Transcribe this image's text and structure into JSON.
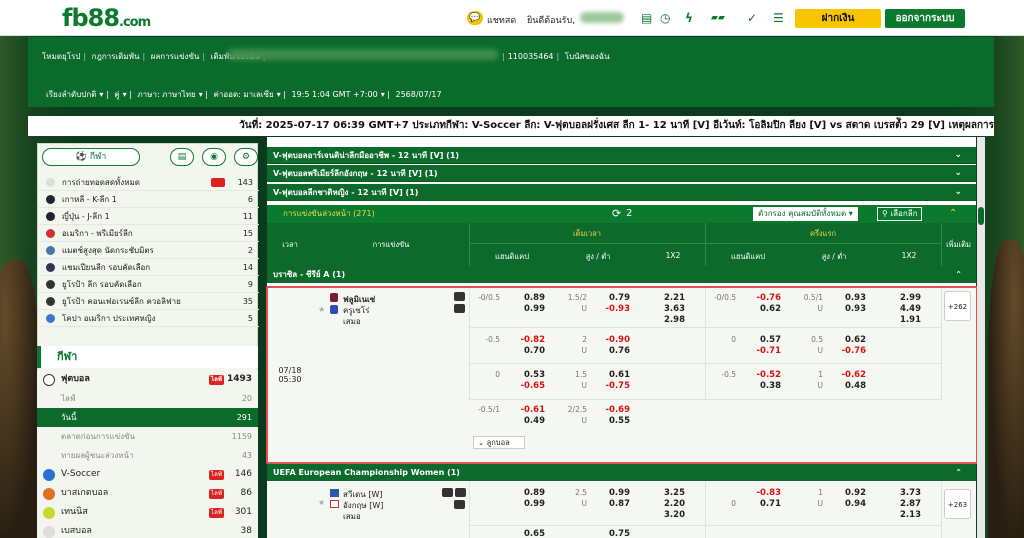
{
  "header": {
    "logo_main": "fb88",
    "logo_sub": ".com",
    "chat_label": "แชทสด",
    "welcome": "ยินดีต้อนรับ,",
    "deposit_label": "ฝากเงิน",
    "logout_label": "ออกจากระบบ"
  },
  "nav": {
    "row1": [
      "โหมดยุโรป",
      "กฎการเดิมพัน",
      "ผลการแข่งขัน",
      "เดิมพันของฉัน"
    ],
    "row1_right": [
      "110035464",
      "โบนัสของฉัน"
    ],
    "row2": [
      "เรียงลำดับปกติ",
      "คู่",
      "ภาษา: ภาษาไทย",
      "ค่าออด: มาเลเซีย",
      "19:5 1:04 GMT +7:00",
      "2568/07/17"
    ]
  },
  "marquee": "วันที่: 2025-07-17 06:39 GMT+7 ประเภทกีฬา: V-Soccer ลีก: V-ฟุตบอลฝรั่งเศส ลีก 1- 12 นาที [V] อีเว้นท์: โอลิมปิก ลียง [V] vs สตาด เบรสต์ัว 29 [V] เหตุผลการ",
  "sidebar": {
    "sports_btn": "กีฬา",
    "leagues": [
      {
        "name": "การถ่ายทอดสดทั้งหมด",
        "count": "143",
        "live": true
      },
      {
        "name": "เกาหลี - K-ลีก 1",
        "count": "6"
      },
      {
        "name": "ญี่ปุ่น - J-ลีก 1",
        "count": "11"
      },
      {
        "name": "อเมริกา - พรีเมียร์ลีก",
        "count": "15"
      },
      {
        "name": "แมตช์สูงสุด นัดกระชับมิตร",
        "count": "2"
      },
      {
        "name": "แชมเปียนลีก รอบคัดเลือก",
        "count": "14"
      },
      {
        "name": "ยูโรป้า ลีก รอบคัดเลือก",
        "count": "9"
      },
      {
        "name": "ยูโรป้า คอนเฟอเรนซ์ลีก ควอลิฟาย",
        "count": "35"
      },
      {
        "name": "โคปา อเมริกา ประเทศหญิง",
        "count": "5"
      }
    ],
    "sport_header": "กีฬา",
    "sports": [
      {
        "name": "ฟุตบอล",
        "live": "ไลฟ์",
        "count": "1493",
        "color": "#fff"
      },
      {
        "name": "ไลฟ์",
        "count": "20",
        "sub": true
      },
      {
        "name": "วันนี้",
        "count": "291",
        "sub": true,
        "active": true
      },
      {
        "name": "ตลาดก่อนการแข่งขัน",
        "count": "1159",
        "sub": true
      },
      {
        "name": "ทายผลผู้ชนะล่วงหน้า",
        "count": "43",
        "sub": true
      },
      {
        "name": "V-Soccer",
        "live": "ไลฟ์",
        "count": "146",
        "color": "#2a6fd0"
      },
      {
        "name": "บาสเกตบอล",
        "live": "ไลฟ์",
        "count": "86",
        "color": "#e07020"
      },
      {
        "name": "เทนนิส",
        "live": "ไลฟ์",
        "count": "301",
        "color": "#c8d830"
      },
      {
        "name": "เบสบอล",
        "count": "38",
        "color": "#ddd"
      }
    ]
  },
  "main": {
    "league_heads": [
      "V-ฟุตบอลอาร์เจนติน่าลีกมืออาชีพ - 12 นาที [V] (1)",
      "V-ฟุตบอลพรีเมียร์ลีกอังกฤษ - 12 นาที [V] (1)",
      "V-ฟุตบอลลีกชาติหญิง - 12 นาที [V] (1)"
    ],
    "ou_label": "การแข่งขันล่วงหน้า (271)",
    "refresh_count": "2",
    "filter_label": "ตัวกรอง คุณสมบัติทั้งหมด",
    "select_league": "เลือกลีก",
    "col": {
      "time": "เวลา",
      "match": "การแข่งขัน",
      "fulltime": "เต็มเวลา",
      "half": "ครึ่งแรก",
      "more": "เพิ่มเติม",
      "hdp": "แฮนดิแคป",
      "ou": "สูง / ต่ำ",
      "x12": "1X2"
    },
    "brazil": "บราซิล - ซีรีย์ A (1)",
    "match1": {
      "date": "07/18",
      "time": "05:30",
      "home": "ฟลูมิเนเซ่",
      "away": "ครูเซโร่",
      "draw": "เสมอ",
      "more": "+262",
      "ft": [
        {
          "hdp": "-0/0.5",
          "h1": "0.89",
          "h2": "0.99",
          "ou": "1.5/2",
          "u": "U",
          "o1": "0.79",
          "o2": "-0.93",
          "x": [
            "2.21",
            "3.63",
            "2.98"
          ]
        },
        {
          "hdp": "-0.5",
          "h1": "-0.82",
          "h2": "0.70",
          "ou": "2",
          "u": "U",
          "o1": "-0.90",
          "o2": "0.76"
        },
        {
          "hdp": "0",
          "h1": "0.53",
          "h2": "-0.65",
          "ou": "1.5",
          "u": "U",
          "o1": "0.61",
          "o2": "-0.75"
        },
        {
          "hdp": "-0.5/1",
          "h1": "-0.61",
          "h2": "0.49",
          "ou": "2/2.5",
          "u": "U",
          "o1": "-0.69",
          "o2": "0.55"
        }
      ],
      "ht": [
        {
          "hdp": "-0/0.5",
          "h1": "-0.76",
          "h2": "0.62",
          "ou": "0.5/1",
          "u": "U",
          "o1": "0.93",
          "o2": "0.93",
          "x": [
            "2.99",
            "4.49",
            "1.91"
          ]
        },
        {
          "hdp": "0",
          "h1": "0.57",
          "h2": "-0.71",
          "ou": "0.5",
          "u": "U",
          "o1": "0.62",
          "o2": "-0.76"
        },
        {
          "hdp": "-0.5",
          "h1": "-0.52",
          "h2": "0.38",
          "ou": "1",
          "u": "U",
          "o1": "-0.62",
          "o2": "0.48"
        }
      ],
      "expand": "ลูกบอล"
    },
    "uefa": "UEFA European Championship Women (1)",
    "match2": {
      "home": "สวีเดน [W]",
      "away": "อังกฤษ [W]",
      "draw": "เสมอ",
      "more": "+263",
      "ft": {
        "h1": "0.89",
        "h2": "0.99",
        "ou": "2.5",
        "u": "U",
        "o1": "0.99",
        "o2": "0.87",
        "x": [
          "3.25",
          "2.20",
          "3.20"
        ]
      },
      "ht": {
        "hdp": "0",
        "h1": "-0.83",
        "h2": "0.71",
        "ou": "1",
        "u": "U",
        "o1": "0.92",
        "o2": "0.94",
        "x": [
          "3.73",
          "2.87",
          "2.13"
        ]
      },
      "partial": [
        "0.65",
        "0.75"
      ]
    }
  }
}
